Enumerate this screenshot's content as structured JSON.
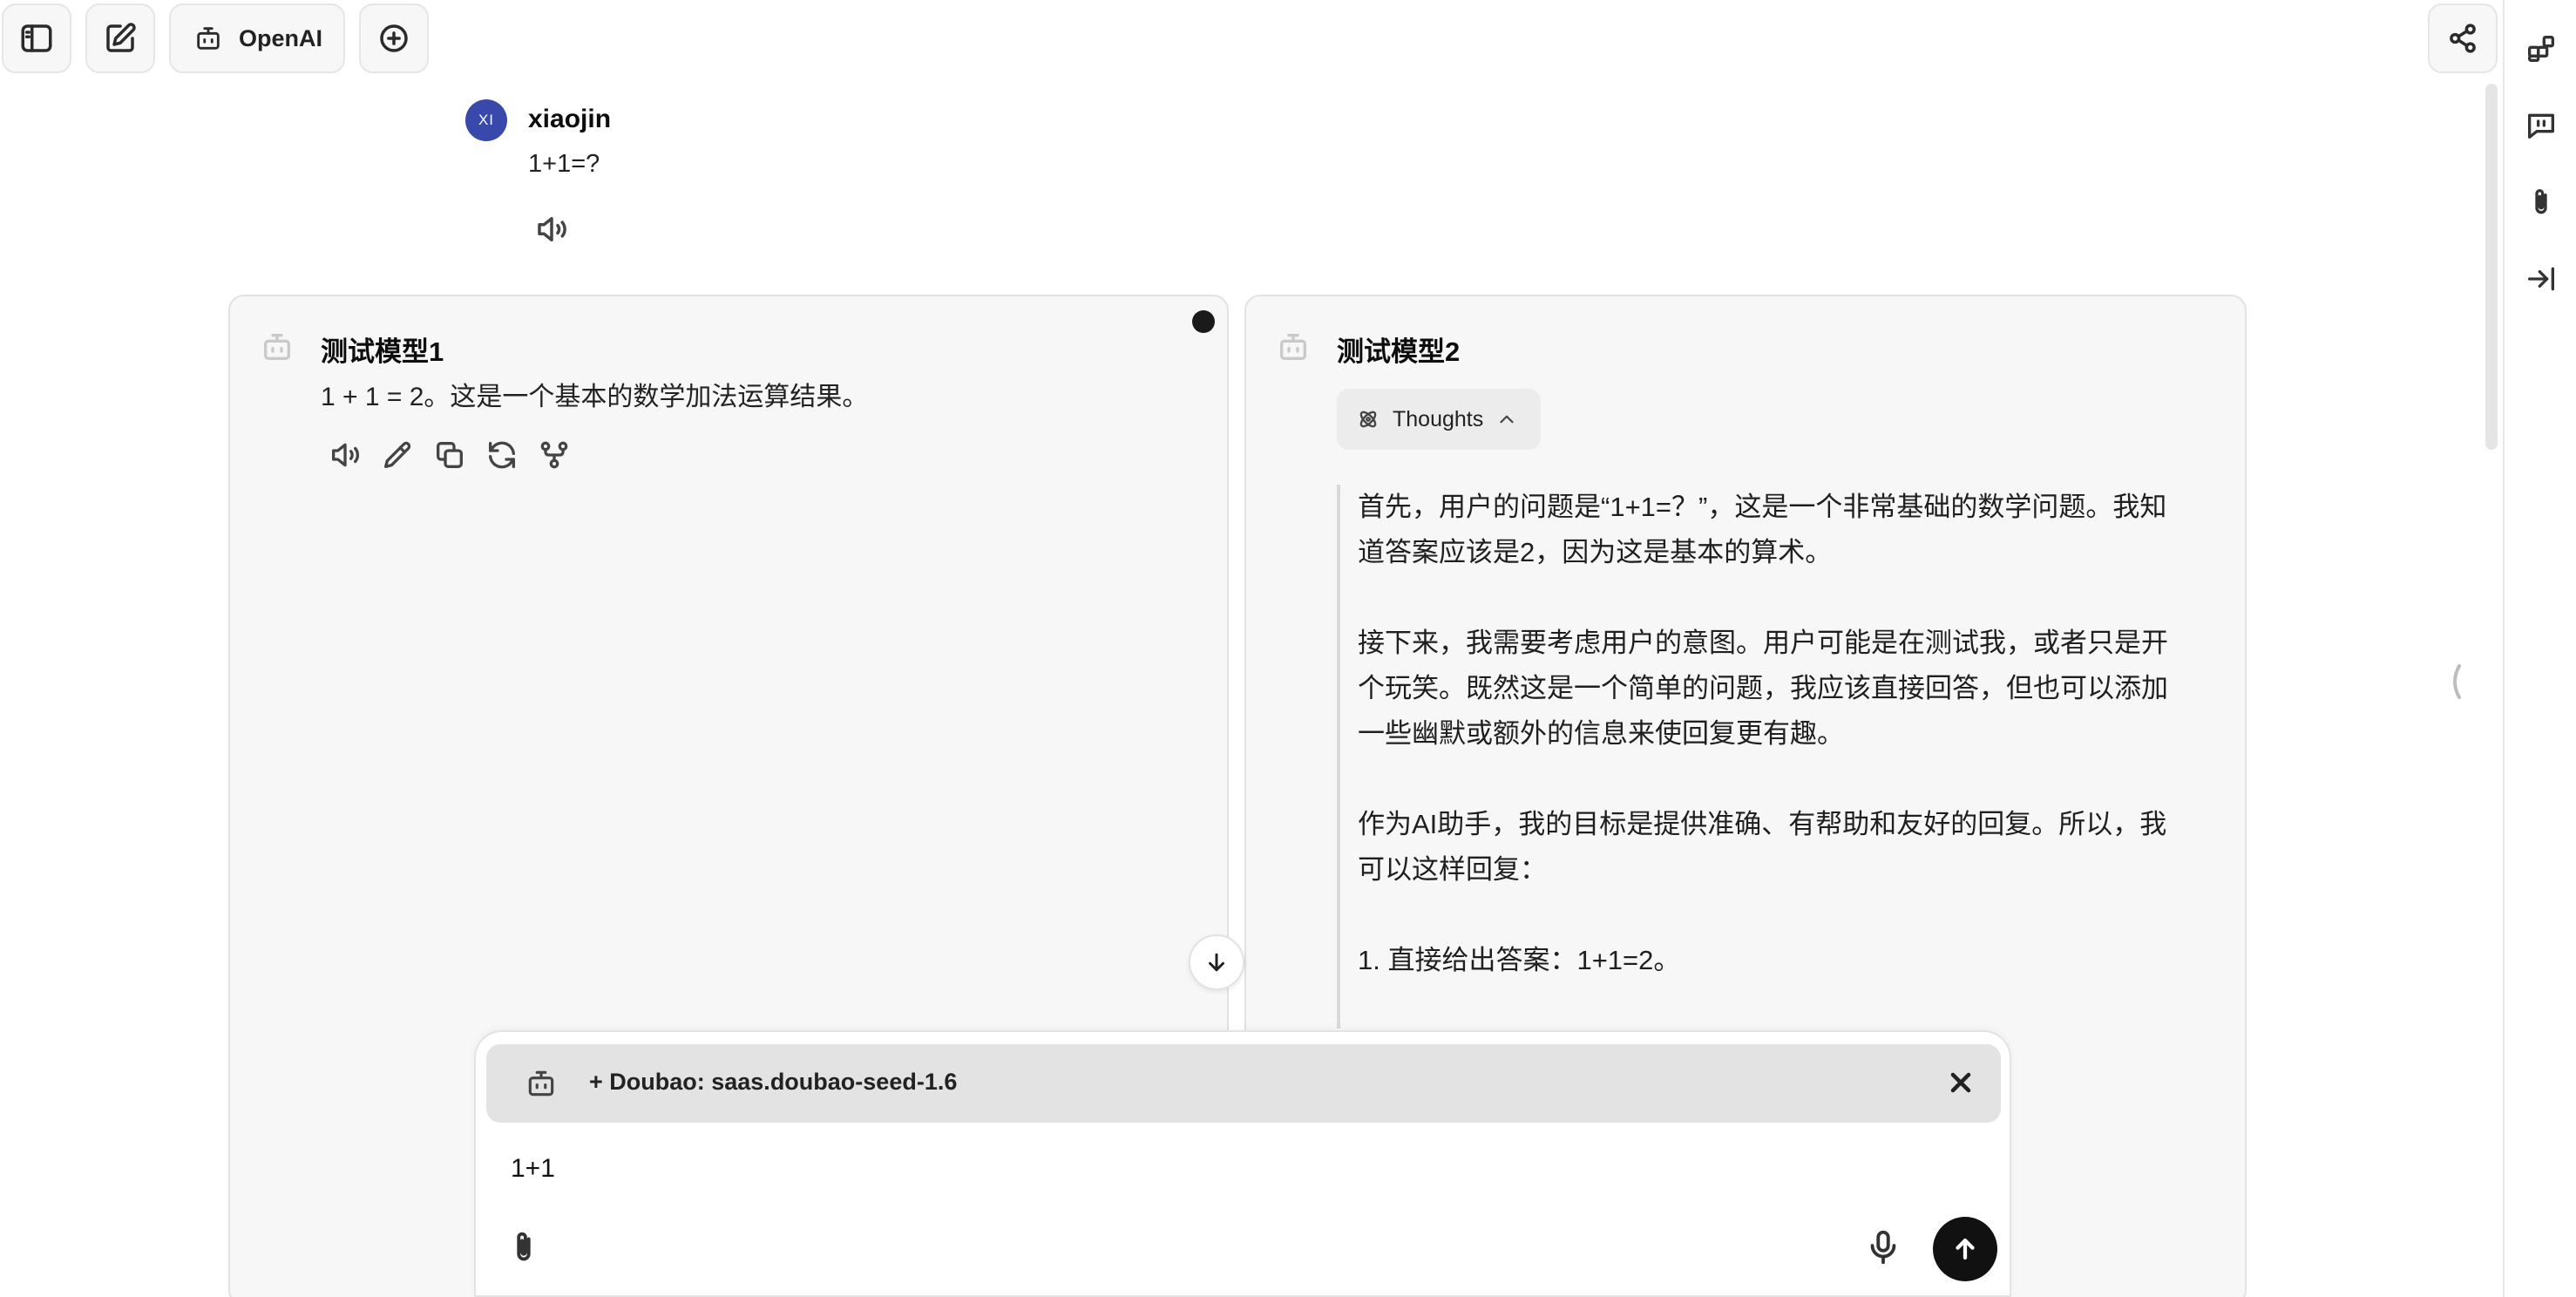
{
  "toolbar": {
    "model_label": "OpenAI"
  },
  "user_message": {
    "avatar_initials": "XI",
    "username": "xiaojin",
    "text": "1+1=?"
  },
  "panels": [
    {
      "title": "测试模型1",
      "text": "1 + 1 = 2。这是一个基本的数学加法运算结果。"
    },
    {
      "title": "测试模型2",
      "thoughts_label": "Thoughts",
      "thought_paragraphs": [
        [
          "首先，用户的问题是“1+1=？”，这是一个非常基础的数学问题。我知",
          "道答案应该是2，因为这是基本的算术。"
        ],
        [
          "接下来，我需要考虑用户的意图。用户可能是在测试我，或者只是开",
          "个玩笑。既然这是一个简单的问题，我应该直接回答，但也可以添加",
          "一些幽默或额外的信息来使回复更有趣。"
        ],
        [
          "作为AI助手，我的目标是提供准确、有帮助和友好的回复。所以，我",
          "可以这样回复："
        ],
        [
          "1. 直接给出答案：1+1=2。"
        ]
      ]
    }
  ],
  "composer": {
    "model_chip": "+ Doubao: saas.doubao-seed-1.6",
    "input_value": "1+1"
  },
  "colors": {
    "avatar": "#3949ab",
    "send_button": "#111111",
    "panel_bg": "#f7f7f7"
  }
}
